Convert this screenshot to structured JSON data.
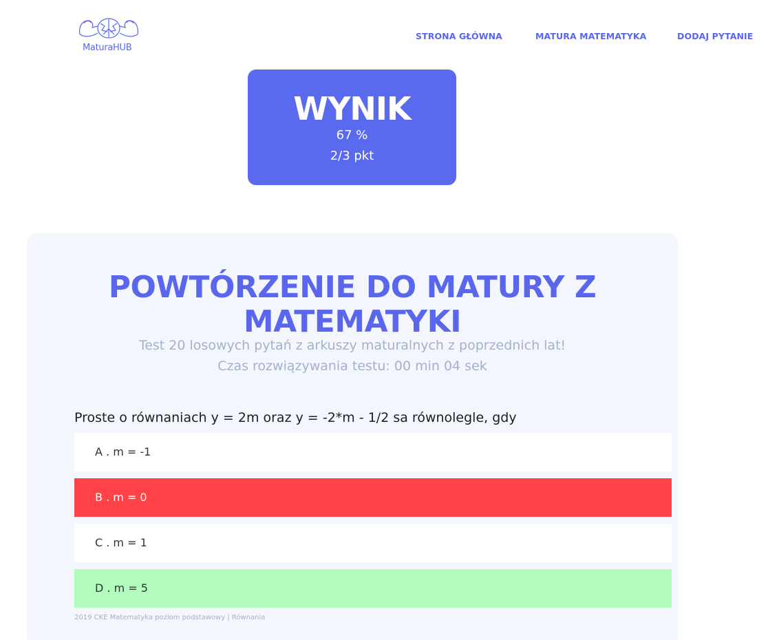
{
  "logo": {
    "text": "MaturaHUB",
    "icon": "brain-muscle-icon"
  },
  "nav": [
    {
      "label": "STRONA GŁÓWNA"
    },
    {
      "label": "MATURA MATEMATYKA"
    },
    {
      "label": "DODAJ PYTANIE"
    }
  ],
  "score": {
    "title": "WYNIK",
    "percent": "67 %",
    "points": "2/3 pkt"
  },
  "quiz": {
    "title": "POWTÓRZENIE DO MATURY Z MATEMATYKI",
    "subtitle": "Test 20 losowych pytań z arkuszy maturalnych z poprzednich lat!",
    "time": "Czas rozwiązywania testu: 00 min 04 sek"
  },
  "question": {
    "text": "Proste o równaniach y = 2m oraz y = -2*m - 1/2 sa równolegle, gdy",
    "answers": [
      {
        "label": "A . m = -1",
        "state": "neutral"
      },
      {
        "label": "B . m = 0",
        "state": "wrong"
      },
      {
        "label": "C . m = 1",
        "state": "neutral"
      },
      {
        "label": "D . m = 5",
        "state": "correct"
      }
    ],
    "source": "2019 CKE Matematyka poziom podstawowy | Równania"
  },
  "colors": {
    "accent": "#5a66ec",
    "wrong": "#ff4247",
    "correct": "#b4fcbe",
    "panel": "#f3f6fd"
  }
}
